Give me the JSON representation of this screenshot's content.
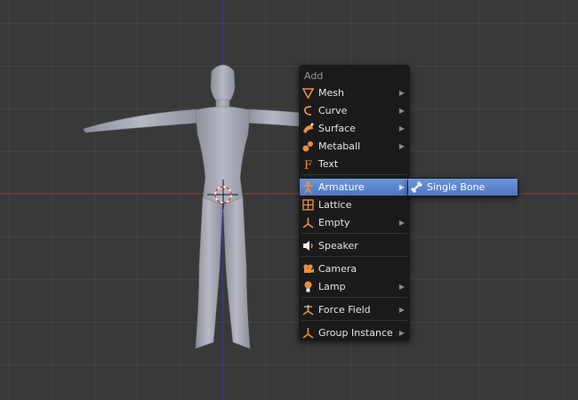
{
  "viewport": {
    "axis_x_color": "#7a3c3c",
    "axis_z_color": "#3e3e82",
    "background": "#393939"
  },
  "add_menu": {
    "title": "Add",
    "items": [
      {
        "label": "Mesh",
        "icon": "mesh-icon",
        "submenu": true
      },
      {
        "label": "Curve",
        "icon": "curve-icon",
        "submenu": true
      },
      {
        "label": "Surface",
        "icon": "surface-icon",
        "submenu": true
      },
      {
        "label": "Metaball",
        "icon": "metaball-icon",
        "submenu": true
      },
      {
        "label": "Text",
        "icon": "text-icon",
        "submenu": false
      },
      {
        "label": "Armature",
        "icon": "armature-icon",
        "submenu": true,
        "highlighted": true
      },
      {
        "label": "Lattice",
        "icon": "lattice-icon",
        "submenu": false
      },
      {
        "label": "Empty",
        "icon": "empty-icon",
        "submenu": true
      },
      {
        "label": "Speaker",
        "icon": "speaker-icon",
        "submenu": false
      },
      {
        "label": "Camera",
        "icon": "camera-icon",
        "submenu": false
      },
      {
        "label": "Lamp",
        "icon": "lamp-icon",
        "submenu": true
      },
      {
        "label": "Force Field",
        "icon": "force-field-icon",
        "submenu": true
      },
      {
        "label": "Group Instance",
        "icon": "group-instance-icon",
        "submenu": true
      }
    ],
    "arrow_glyph": "▶"
  },
  "armature_submenu": {
    "items": [
      {
        "label": "Single Bone",
        "icon": "bone-icon",
        "highlighted": true
      }
    ]
  },
  "colors": {
    "accent_orange": "#e9913a",
    "highlight_blue": "#5a82cf"
  }
}
